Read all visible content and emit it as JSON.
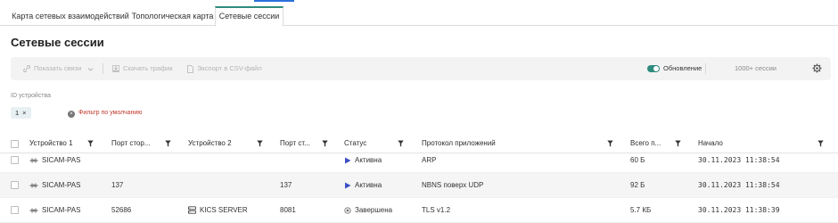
{
  "tabs": [
    {
      "label": "Карта сетевых взаимодействий"
    },
    {
      "label": "Топологическая карта"
    },
    {
      "label": "Сетевые сессии",
      "active": true
    }
  ],
  "page": {
    "title": "Сетевые сессии"
  },
  "toolbar": {
    "show_links": "Показать связи",
    "download_traffic": "Скачать трафик",
    "export_csv": "Экспорт в CSV-файл",
    "update_label": "Обновление",
    "update_enabled": true,
    "session_count": "1000+ сессии"
  },
  "filters": {
    "device_id_label": "ID устройства",
    "device_chip": "1",
    "default_filter": "Фильтр по умолчанию"
  },
  "table": {
    "columns": [
      "Устройство 1",
      "Порт стор...",
      "Устройство 2",
      "Порт ст...",
      "Статус",
      "Протокол приложений",
      "Всего п...",
      "Начало"
    ],
    "rows": [
      {
        "device1": "SICAM-PAS",
        "port1": "",
        "device2": "",
        "port2": "",
        "status": "Активна",
        "status_type": "active",
        "protocol": "ARP",
        "total": "60 Б",
        "start": "30.11.2023 11:38:54"
      },
      {
        "device1": "SICAM-PAS",
        "port1": "137",
        "device2": "",
        "port2": "137",
        "status": "Активна",
        "status_type": "active",
        "protocol": "NBNS поверх UDP",
        "total": "92 Б",
        "start": "30.11.2023 11:38:54"
      },
      {
        "device1": "SICAM-PAS",
        "port1": "52686",
        "device2": "KICS SERVER",
        "port2": "8081",
        "status": "Завершена",
        "status_type": "finished",
        "protocol": "TLS v1.2",
        "total": "5.7 КБ",
        "start": "30.11.2023 11:38:39"
      }
    ]
  },
  "colors": {
    "accent": "#2f8b7e",
    "active_status": "#3b4fc4",
    "filter_red": "#c0392b",
    "top_indicator": "#2a6fdb"
  }
}
